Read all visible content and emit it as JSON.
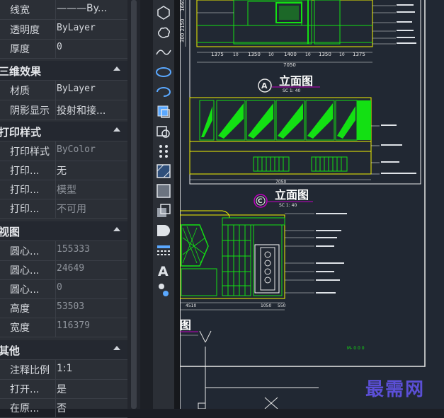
{
  "properties": {
    "rows_top": [
      {
        "key": "线宽",
        "value": "———By..."
      },
      {
        "key": "透明度",
        "value": "ByLayer"
      },
      {
        "key": "厚度",
        "value": "0"
      }
    ],
    "section_3d": {
      "title": "三维效果",
      "rows": [
        {
          "key": "材质",
          "value": "ByLayer"
        },
        {
          "key": "阴影显示",
          "value": "投射和接..."
        }
      ]
    },
    "section_print": {
      "title": "打印样式",
      "rows": [
        {
          "key": "打印样式",
          "value": "ByColor"
        },
        {
          "key": "打印...",
          "value": "无"
        },
        {
          "key": "打印...",
          "value": "模型"
        },
        {
          "key": "打印...",
          "value": "不可用"
        }
      ]
    },
    "section_view": {
      "title": "视图",
      "rows": [
        {
          "key": "圆心...",
          "value": "155333"
        },
        {
          "key": "圆心...",
          "value": "24649"
        },
        {
          "key": "圆心...",
          "value": "0"
        },
        {
          "key": "高度",
          "value": "53503"
        },
        {
          "key": "宽度",
          "value": "116379"
        }
      ]
    },
    "section_other": {
      "title": "其他",
      "rows": [
        {
          "key": "注释比例",
          "value": "1:1"
        },
        {
          "key": "打开...",
          "value": "是"
        },
        {
          "key": "在原...",
          "value": "否"
        }
      ]
    }
  },
  "toolbar": {
    "icons": [
      "polygon-icon",
      "revision-cloud-icon",
      "spline-icon",
      "ellipse-icon",
      "ellipse-arc-icon",
      "insert-block-icon",
      "make-block-icon",
      "point-icon",
      "hatch-icon",
      "gradient-icon",
      "region-icon",
      "wipeout-icon",
      "table-icon",
      "multiline-text-icon",
      "add-selected-icon"
    ]
  },
  "drawing": {
    "dims_top": [
      "1375",
      "10",
      "1350",
      "10",
      "1400",
      "10",
      "1350",
      "10",
      "1375"
    ],
    "total_top": "7050",
    "title_a": "立面图",
    "marker_a": "A",
    "scale_a": "SC 1: 40",
    "total_mid": "7050",
    "title_c": "立面图",
    "marker_c": "C",
    "scale_c": "SC 1: 40",
    "dims_bottom": [
      "4510",
      "1050",
      "550"
    ],
    "title_partial": "图",
    "left_dims": [
      "1660",
      "300 2150"
    ],
    "stamp": "M- 0 0 0"
  },
  "colors": {
    "canvas_bg": "#212833",
    "green": "#13e013",
    "yellow": "#f2f200",
    "white": "#ffffff",
    "magenta": "#c000c0",
    "watermark": "#5b4fd6"
  },
  "watermark": "最需网"
}
